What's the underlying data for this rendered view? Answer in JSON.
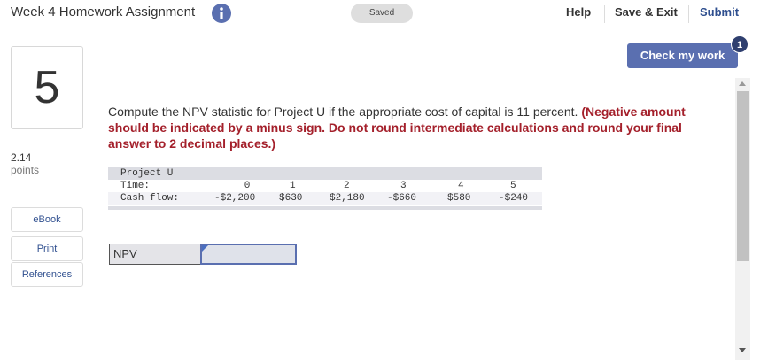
{
  "header": {
    "title": "Week 4 Homework Assignment",
    "saved_label": "Saved",
    "help_label": "Help",
    "save_exit_label": "Save & Exit",
    "submit_label": "Submit"
  },
  "check_work": {
    "label": "Check my work",
    "badge": "1"
  },
  "sidebar": {
    "question_number": "5",
    "points_value": "2.14",
    "points_label": "points",
    "items": [
      {
        "label": "eBook"
      },
      {
        "label": "Print"
      },
      {
        "label": "References"
      }
    ]
  },
  "question": {
    "text": "Compute the NPV statistic for Project U if the appropriate cost of capital is 11 percent.",
    "instruction": "(Negative amount should be indicated by a minus sign. Do not round intermediate calculations and round your final answer to 2 decimal places.)"
  },
  "project_table": {
    "project_label": "Project U",
    "time_label": "Time:",
    "cashflow_label": "Cash flow:",
    "times": [
      "0",
      "1",
      "2",
      "3",
      "4",
      "5"
    ],
    "cash_flows": [
      "-$2,200",
      "$630",
      "$2,180",
      "-$660",
      "$580",
      "-$240"
    ]
  },
  "answer": {
    "label": "NPV",
    "value": ""
  },
  "colors": {
    "accent": "#5a6fb0",
    "instruction_red": "#a4202b",
    "submit_blue": "#2f4f8f"
  },
  "icons": {
    "info": "info-icon",
    "scroll_up": "scroll-up-icon",
    "scroll_down": "scroll-down-icon"
  }
}
